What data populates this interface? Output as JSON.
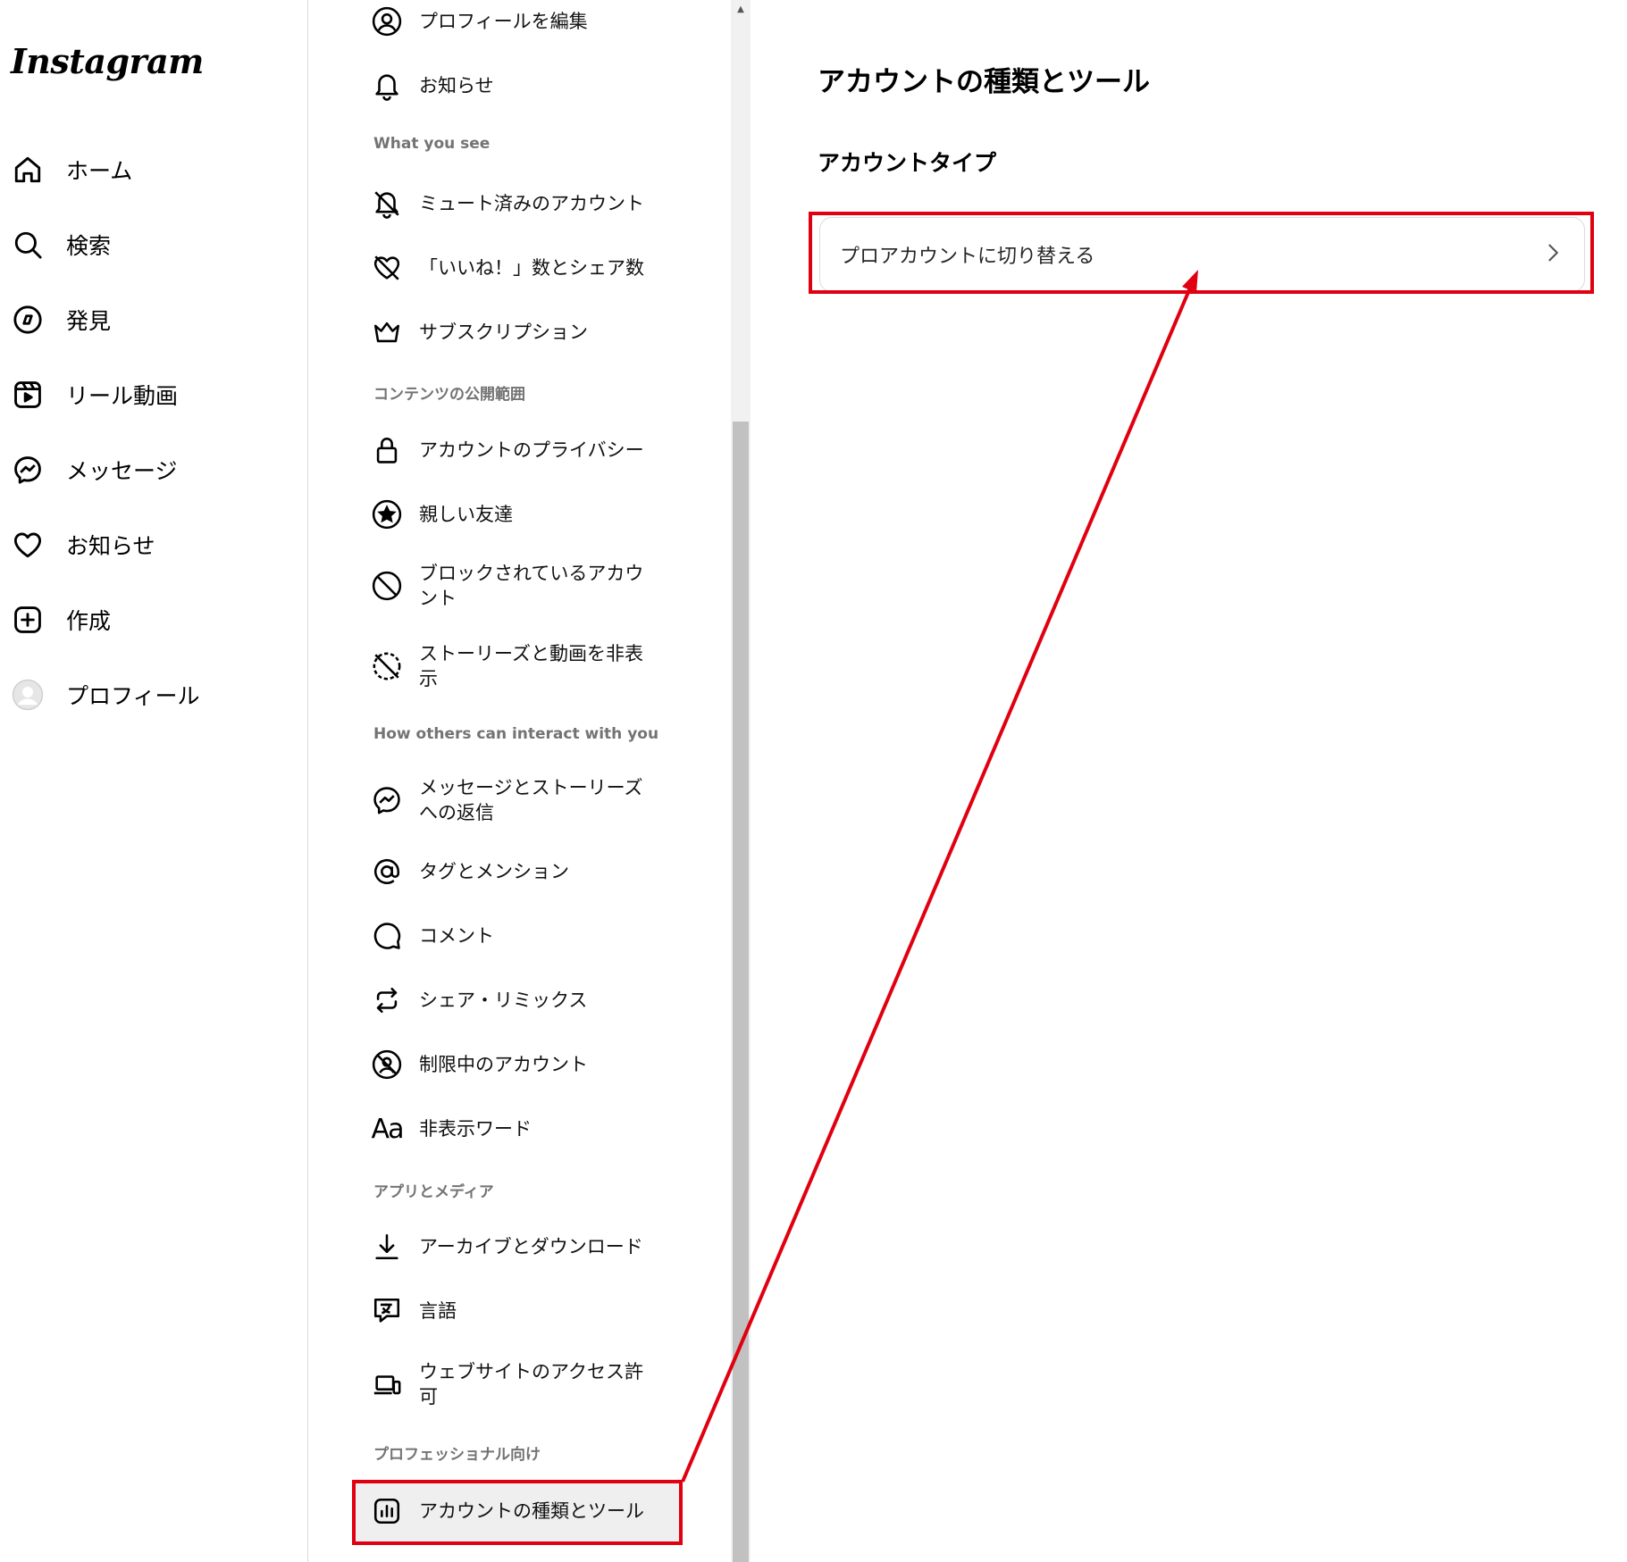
{
  "brand": {
    "logo_text": "Instagram"
  },
  "nav": {
    "items": [
      {
        "label": "ホーム",
        "icon": "home-icon"
      },
      {
        "label": "検索",
        "icon": "search-icon"
      },
      {
        "label": "発見",
        "icon": "compass-icon"
      },
      {
        "label": "リール動画",
        "icon": "reels-icon"
      },
      {
        "label": "メッセージ",
        "icon": "messenger-icon"
      },
      {
        "label": "お知らせ",
        "icon": "heart-icon"
      },
      {
        "label": "作成",
        "icon": "plus-square-icon"
      },
      {
        "label": "プロフィール",
        "icon": "avatar-icon"
      }
    ]
  },
  "settings": {
    "items": {
      "edit_profile": "プロフィールを編集",
      "notifications": "お知らせ",
      "muted": "ミュート済みのアカウント",
      "likes": "「いいね！」数とシェア数",
      "subscriptions": "サブスクリプション",
      "privacy": "アカウントのプライバシー",
      "close_friends": "親しい友達",
      "blocked": "ブロックされているアカウント",
      "hide_story": "ストーリーズと動画を非表示",
      "message_replies": "メッセージとストーリーズへの返信",
      "tags": "タグとメンション",
      "comments": "コメント",
      "share_remix": "シェア・リミックス",
      "restricted": "制限中のアカウント",
      "hidden_words": "非表示ワード",
      "archive": "アーカイブとダウンロード",
      "language": "言語",
      "website_access": "ウェブサイトのアクセス許可",
      "account_type_tools": "アカウントの種類とツール"
    },
    "headings": {
      "what_you_see": "What you see",
      "content_visibility": "コンテンツの公開範囲",
      "interact": "How others can interact with you",
      "apps_media": "アプリとメディア",
      "professional": "プロフェッショナル向け"
    }
  },
  "main": {
    "title": "アカウントの種類とツール",
    "section": "アカウントタイプ",
    "switch_label": "プロアカウントに切り替える"
  },
  "colors": {
    "annotation": "#e00010",
    "border": "#dbdbdb",
    "muted_text": "#737373"
  }
}
